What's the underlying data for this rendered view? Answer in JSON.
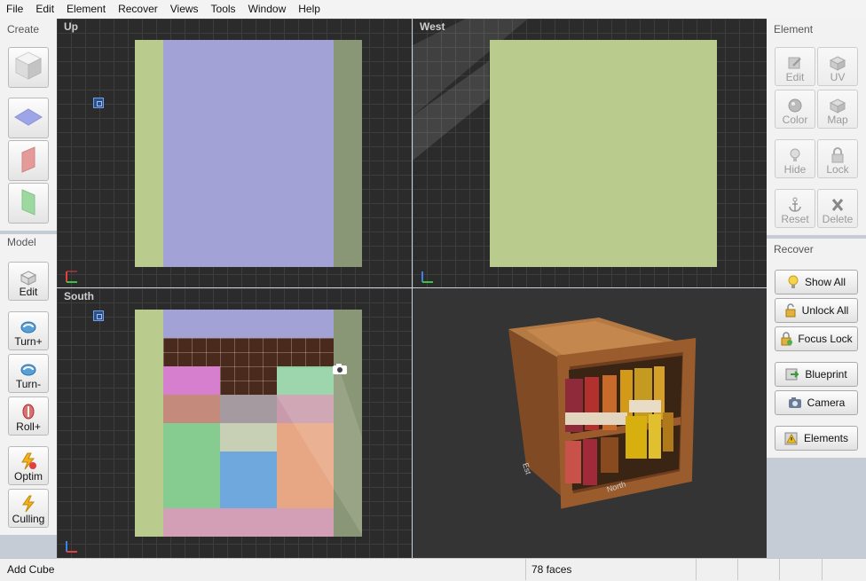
{
  "menu": [
    "File",
    "Edit",
    "Element",
    "Recover",
    "Views",
    "Tools",
    "Window",
    "Help"
  ],
  "left": {
    "create_title": "Create",
    "model_title": "Model",
    "model_buttons": [
      {
        "label": "Edit",
        "icon": "edit-cube-icon"
      },
      {
        "label": "Turn+",
        "icon": "rotate-cw-icon"
      },
      {
        "label": "Turn-",
        "icon": "rotate-ccw-icon"
      },
      {
        "label": "Roll+",
        "icon": "roll-icon"
      },
      {
        "label": "Optim",
        "icon": "optimize-icon"
      },
      {
        "label": "Culling",
        "icon": "lightning-icon"
      }
    ]
  },
  "right": {
    "element_title": "Element",
    "element_buttons": [
      {
        "label": "Edit"
      },
      {
        "label": "UV"
      },
      {
        "label": "Color"
      },
      {
        "label": "Map"
      },
      {
        "label": "Hide"
      },
      {
        "label": "Lock"
      },
      {
        "label": "Reset"
      },
      {
        "label": "Delete"
      }
    ],
    "recover_title": "Recover",
    "recover_buttons": [
      {
        "label": "Show All"
      },
      {
        "label": "Unlock All"
      },
      {
        "label": "Focus Lock"
      },
      {
        "label": "Blueprint"
      },
      {
        "label": "Camera"
      },
      {
        "label": "Elements"
      }
    ]
  },
  "viewports": {
    "up": "Up",
    "west": "West",
    "south": "South",
    "axis_east": "Est",
    "axis_north": "North"
  },
  "status": {
    "left": "Add Cube",
    "faces": "78 faces"
  },
  "colors": {
    "green": "#b9cb8d",
    "purple": "#a2a2d6",
    "dark_green": "#8a9776"
  }
}
